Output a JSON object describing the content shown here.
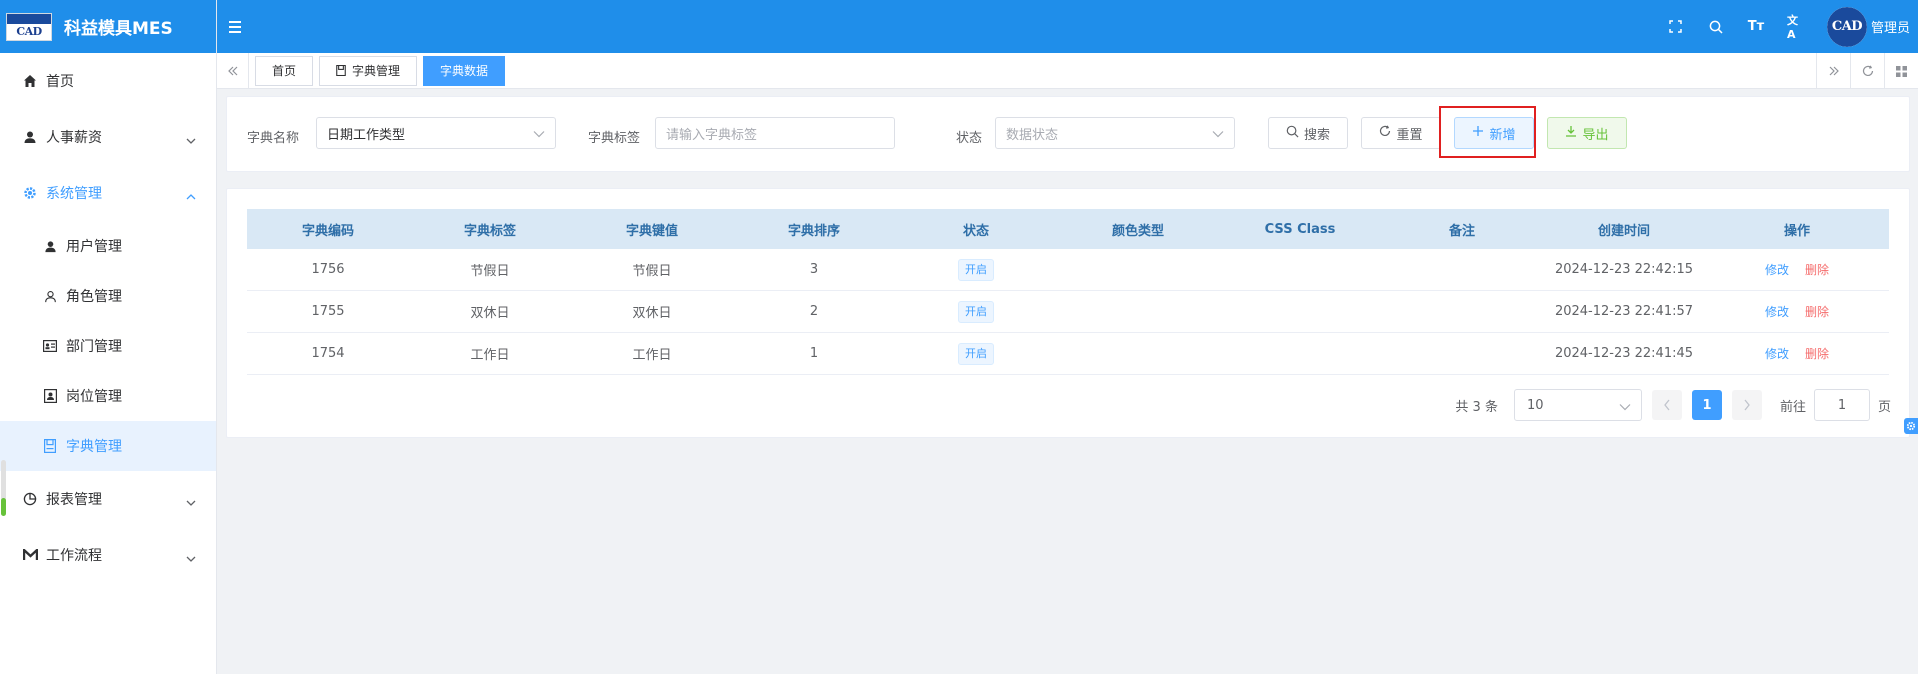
{
  "app": {
    "title": "科益模具MES",
    "logo_text": "CAD"
  },
  "sidebar": {
    "items": [
      {
        "label": "首页",
        "icon": "home-icon"
      },
      {
        "label": "人事薪资",
        "icon": "user-icon",
        "expandable": true
      },
      {
        "label": "系统管理",
        "icon": "gear-icon",
        "expanded": true
      },
      {
        "label": "报表管理",
        "icon": "pie-chart-icon",
        "expandable": true
      },
      {
        "label": "工作流程",
        "icon": "flow-icon",
        "expandable": true
      }
    ],
    "sub_items": [
      {
        "label": "用户管理",
        "icon": "user-filled-icon"
      },
      {
        "label": "角色管理",
        "icon": "user-outline-icon"
      },
      {
        "label": "部门管理",
        "icon": "id-card-icon"
      },
      {
        "label": "岗位管理",
        "icon": "badge-icon"
      },
      {
        "label": "字典管理",
        "icon": "book-icon",
        "active": true
      }
    ]
  },
  "header": {
    "icons": [
      "fullscreen-icon",
      "search-icon",
      "font-size-icon",
      "translate-icon"
    ],
    "font_icon_text": "Tт",
    "translate_icon_text": "文A",
    "user_name": "管理员",
    "avatar_text": "CAD"
  },
  "tabs": [
    {
      "label": "首页"
    },
    {
      "label": "字典管理"
    },
    {
      "label": "字典数据",
      "active": true
    }
  ],
  "search": {
    "dict_name_label": "字典名称",
    "dict_name_value": "日期工作类型",
    "dict_label_label": "字典标签",
    "dict_label_placeholder": "请输入字典标签",
    "status_label": "状态",
    "status_placeholder": "数据状态",
    "search_button": "搜索",
    "reset_button": "重置",
    "add_button": "新增",
    "export_button": "导出"
  },
  "table": {
    "columns": [
      "字典编码",
      "字典标签",
      "字典键值",
      "字典排序",
      "状态",
      "颜色类型",
      "CSS Class",
      "备注",
      "创建时间",
      "操作"
    ],
    "rows": [
      {
        "code": "1756",
        "label": "节假日",
        "value": "节假日",
        "sort": "3",
        "status": "开启",
        "color": "",
        "css": "",
        "remark": "",
        "created": "2024-12-23 22:42:15"
      },
      {
        "code": "1755",
        "label": "双休日",
        "value": "双休日",
        "sort": "2",
        "status": "开启",
        "color": "",
        "css": "",
        "remark": "",
        "created": "2024-12-23 22:41:57"
      },
      {
        "code": "1754",
        "label": "工作日",
        "value": "工作日",
        "sort": "1",
        "status": "开启",
        "color": "",
        "css": "",
        "remark": "",
        "created": "2024-12-23 22:41:45"
      }
    ],
    "edit_label": "修改",
    "delete_label": "删除"
  },
  "pagination": {
    "total_text": "共 3 条",
    "page_size": "10",
    "current_page": "1",
    "goto_label": "前往",
    "goto_value": "1",
    "page_unit": "页"
  },
  "colors": {
    "primary": "#1f8eea",
    "accent": "#409eff",
    "danger": "#f56c6c",
    "success": "#67c23a"
  }
}
